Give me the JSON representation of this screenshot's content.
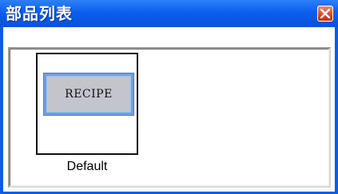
{
  "window": {
    "title": "部品列表",
    "close_icon": "close-icon"
  },
  "parts": [
    {
      "button_label": "RECIPE",
      "caption": "Default"
    }
  ],
  "colors": {
    "titlebar": "#0b5ef0",
    "close_button": "#d8451f",
    "button_face": "#c4c4cc",
    "button_border": "#6f9fe0"
  }
}
